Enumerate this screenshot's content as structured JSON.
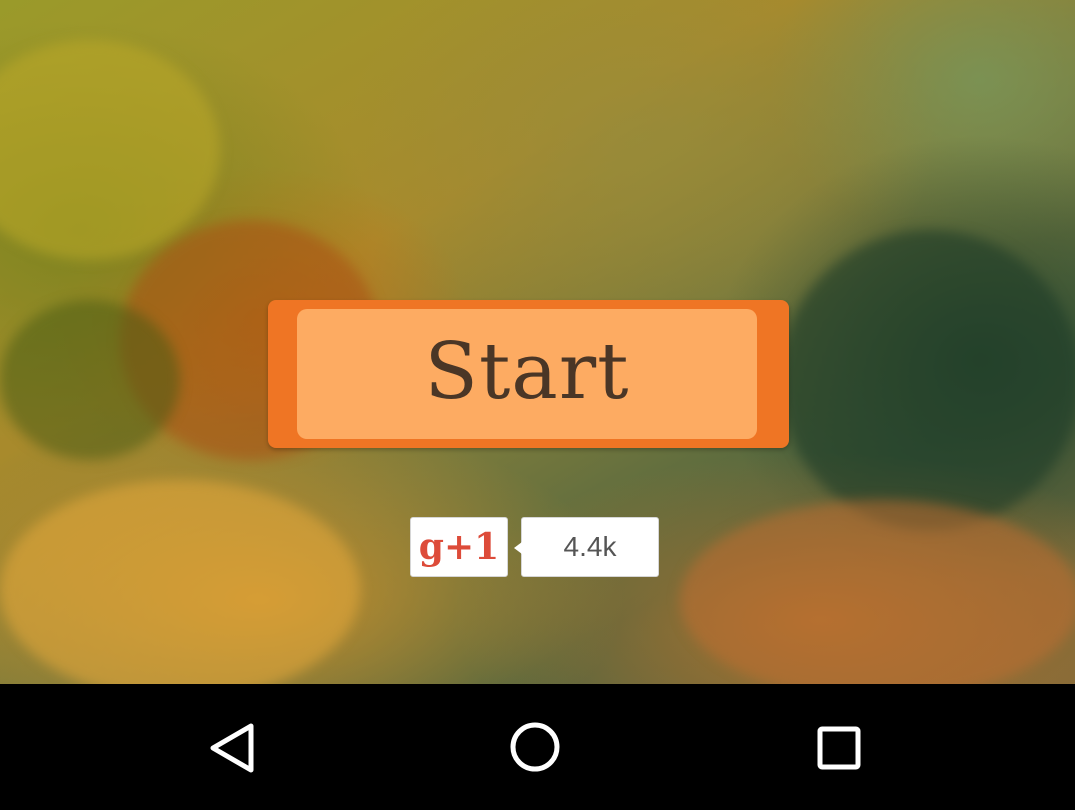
{
  "app": {
    "start_label": "Start",
    "gplus_label": "g+1",
    "gplus_count": "4.4k"
  },
  "colors": {
    "start_outer": "#ef7524",
    "start_inner": "#fdab62",
    "start_text": "#4a3626",
    "gplus_red": "#dd4b39"
  },
  "navbar": {
    "items": [
      {
        "name": "back",
        "icon": "back-triangle-icon"
      },
      {
        "name": "home",
        "icon": "home-circle-icon"
      },
      {
        "name": "recents",
        "icon": "recents-square-icon"
      }
    ]
  }
}
